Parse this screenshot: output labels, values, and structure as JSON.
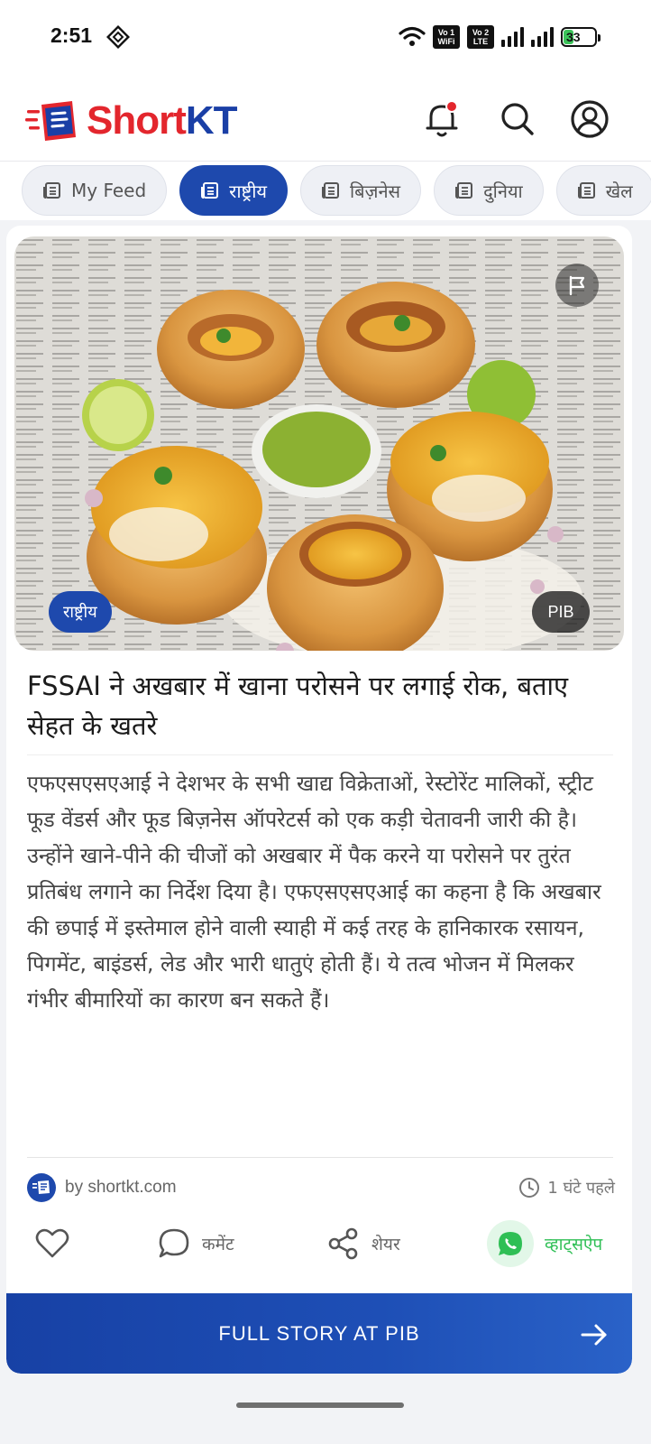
{
  "status_bar": {
    "time": "2:51",
    "sim1_top": "Vo 1",
    "sim1_bottom": "WiFi",
    "sim2_top": "Vo 2",
    "sim2_bottom": "LTE",
    "battery": "33",
    "battery_level": 0.33
  },
  "header": {
    "logo_short": "Short",
    "logo_kt": "KT",
    "notification_dot_color": "#e3262d"
  },
  "tabs": [
    {
      "label": "My Feed",
      "active": false
    },
    {
      "label": "राष्ट्रीय",
      "active": true
    },
    {
      "label": "बिज़नेस",
      "active": false
    },
    {
      "label": "दुनिया",
      "active": false
    },
    {
      "label": "खेल",
      "active": false
    }
  ],
  "article": {
    "category": "राष्ट्रीय",
    "source_badge": "PIB",
    "headline": "FSSAI ने अखबार में खाना परोसने पर लगाई रोक, बताए सेहत के खतरे",
    "body": "एफएसएसएआई ने देशभर के सभी खाद्य विक्रेताओं, रेस्टोरेंट मालिकों, स्ट्रीट फूड वेंडर्स और फूड बिज़नेस ऑपरेटर्स को एक कड़ी चेतावनी जारी की है। उन्होंने खाने-पीने की चीजों को अखबार में पैक करने या परोसने पर तुरंत प्रतिबंध लगाने का निर्देश दिया है। एफएसएसएआई का कहना है कि अखबार की छपाई में इस्तेमाल होने वाली स्याही में कई तरह के हानिकारक रसायन, पिगमेंट, बाइंडर्स, लेड और भारी धातुएं होती हैं। ये तत्व भोजन में मिलकर गंभीर बीमारियों का कारण बन सकते हैं।",
    "source": "by shortkt.com",
    "time_ago": "1 घंटे पहले"
  },
  "actions": {
    "comment": "कमेंट",
    "share": "शेयर",
    "whatsapp": "व्हाट्सऐप"
  },
  "cta": {
    "label": "FULL STORY AT PIB"
  },
  "colors": {
    "brand_blue": "#1e49ad",
    "brand_red": "#e3262d",
    "whatsapp_green": "#2fbf55"
  }
}
